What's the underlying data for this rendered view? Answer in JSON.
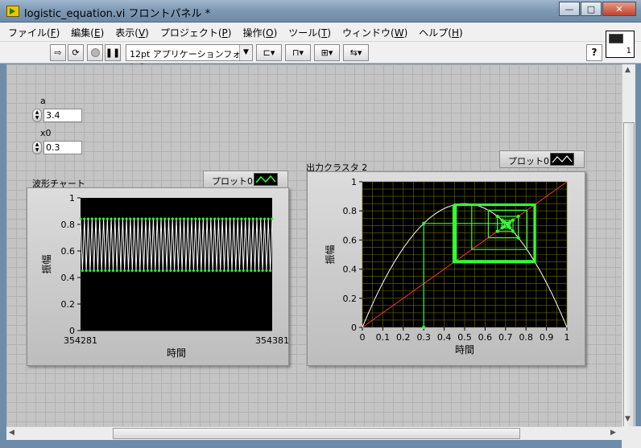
{
  "window": {
    "title": "logistic_equation.vi フロントパネル *",
    "minimize": "—",
    "maximize": "□",
    "close": "✕"
  },
  "menu": [
    {
      "label": "ファイル(",
      "key": "F",
      "end": ")"
    },
    {
      "label": "編集(",
      "key": "E",
      "end": ")"
    },
    {
      "label": "表示(",
      "key": "V",
      "end": ")"
    },
    {
      "label": "プロジェクト(",
      "key": "P",
      "end": ")"
    },
    {
      "label": "操作(",
      "key": "O",
      "end": ")"
    },
    {
      "label": "ツール(",
      "key": "T",
      "end": ")"
    },
    {
      "label": "ウィンドウ(",
      "key": "W",
      "end": ")"
    },
    {
      "label": "ヘルプ(",
      "key": "H",
      "end": ")"
    }
  ],
  "toolbar": {
    "font": "12pt アプリケーションフォント",
    "help": "?",
    "vi_icon_number": "1"
  },
  "controls": {
    "a": {
      "label": "a",
      "value": "3.4"
    },
    "x0": {
      "label": "x0",
      "value": "0.3"
    }
  },
  "waveform_chart": {
    "title": "波形チャート",
    "legend": "プロット0",
    "ylabel": "振幅",
    "xlabel": "時間",
    "yticks": [
      "1",
      "0.8",
      "0.6",
      "0.4",
      "0.2",
      "0"
    ],
    "x_start": "354281",
    "x_end": "354381"
  },
  "xy_graph": {
    "title": "出力クラスタ 2",
    "legend": "プロット0",
    "ylabel": "振幅",
    "xlabel": "時間",
    "yticks": [
      "1",
      "0.8",
      "0.6",
      "0.4",
      "0.2",
      "0"
    ],
    "xticks": [
      "0",
      "0.1",
      "0.2",
      "0.3",
      "0.4",
      "0.5",
      "0.6",
      "0.7",
      "0.8",
      "0.9",
      "1"
    ]
  },
  "colors": {
    "plot_green": "#33ff33",
    "identity_line": "#ff3333",
    "parabola": "#ffffff",
    "plot_bg": "#000000",
    "grid": "#6b6b00"
  },
  "chart_data": [
    {
      "type": "line",
      "title": "波形チャート",
      "ylabel": "振幅",
      "xlabel": "時間",
      "xlim": [
        354281,
        354381
      ],
      "ylim": [
        0,
        1
      ],
      "series": [
        {
          "values_alternating": [
            0.842,
            0.452
          ],
          "points": 101
        }
      ]
    },
    {
      "type": "line",
      "title": "出力クラスタ 2",
      "ylabel": "振幅",
      "xlabel": "時間",
      "xlim": [
        0,
        1
      ],
      "ylim": [
        0,
        1
      ],
      "a": 3.4,
      "x0": 0.3
    }
  ]
}
